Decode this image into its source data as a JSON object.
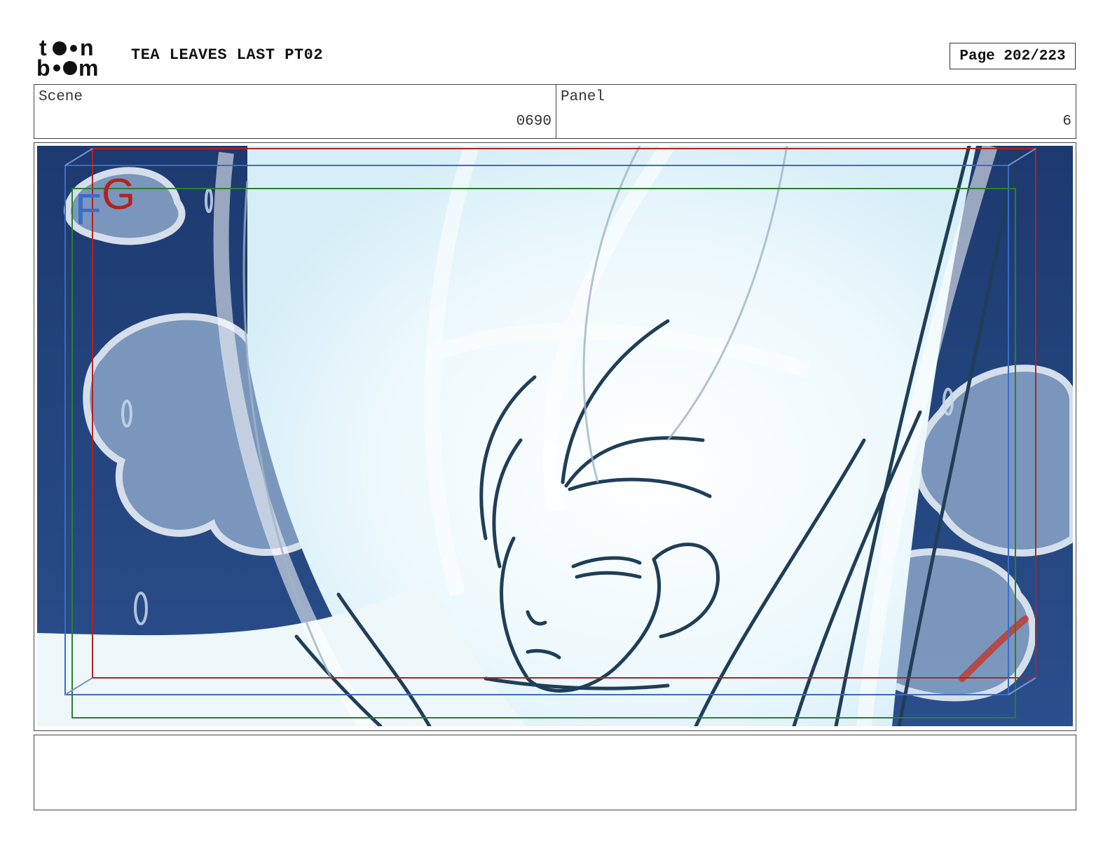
{
  "header": {
    "logo": {
      "word_top": "toon",
      "word_bottom": "boom",
      "icon": "toon-boom-logo"
    },
    "title": "TEA LEAVES LAST PT02",
    "page": "Page 202/223"
  },
  "info": {
    "scene_label": "Scene",
    "scene_value": "0690",
    "panel_label": "Panel",
    "panel_value": "6"
  },
  "frame": {
    "layer_label_f": "F",
    "layer_label_g": "G",
    "colors": {
      "safe_area_red": "#b22222",
      "frame_blue": "#3a6cc8",
      "frame_green": "#2e7d32",
      "night_sky": "#1e3f78",
      "line_art": "#1f3e58"
    }
  },
  "notes": {
    "text": ""
  }
}
